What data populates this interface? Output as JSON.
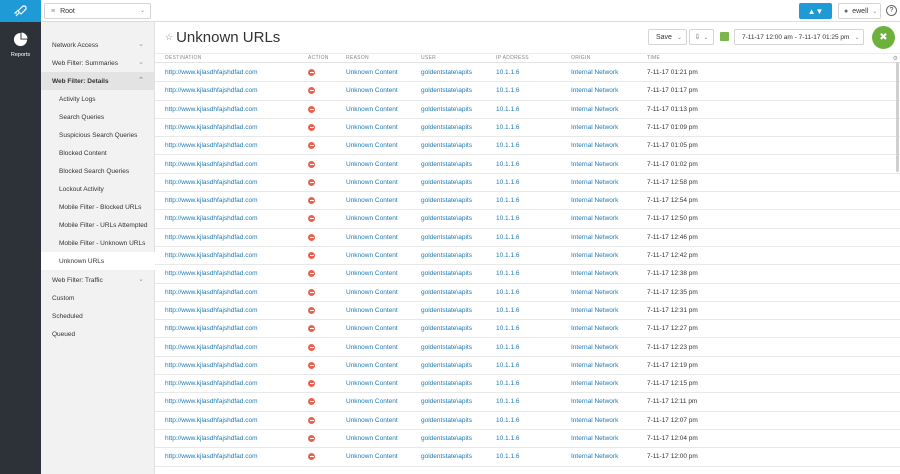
{
  "topbar": {
    "root_label": "Root",
    "user_label": "ewell",
    "help_label": "?"
  },
  "rail": {
    "reports_label": "Reports"
  },
  "sidebar": {
    "items": [
      {
        "label": "Network Access",
        "level": "top"
      },
      {
        "label": "Web Filter: Summaries",
        "level": "top"
      },
      {
        "label": "Web Filter: Details",
        "level": "top"
      },
      {
        "label": "Activity Logs",
        "level": "sub"
      },
      {
        "label": "Search Queries",
        "level": "sub"
      },
      {
        "label": "Suspicious Search Queries",
        "level": "sub"
      },
      {
        "label": "Blocked Content",
        "level": "sub"
      },
      {
        "label": "Blocked Search Queries",
        "level": "sub"
      },
      {
        "label": "Lockout Activity",
        "level": "sub"
      },
      {
        "label": "Mobile Filter - Blocked URLs",
        "level": "sub"
      },
      {
        "label": "Mobile Filter - URLs Attempted",
        "level": "sub"
      },
      {
        "label": "Mobile Filter - Unknown URLs",
        "level": "sub"
      },
      {
        "label": "Unknown URLs",
        "level": "sub"
      },
      {
        "label": "Web Filter: Traffic",
        "level": "top"
      },
      {
        "label": "Custom",
        "level": "top"
      },
      {
        "label": "Scheduled",
        "level": "top"
      },
      {
        "label": "Queued",
        "level": "top"
      }
    ]
  },
  "main": {
    "title": "Unknown URLs",
    "save_label": "Save",
    "date_range": "7-11-17 12:00 am - 7-11-17 01:25 pm"
  },
  "table": {
    "columns": [
      "DESTINATION",
      "ACTION",
      "REASON",
      "USER",
      "IP ADDRESS",
      "ORIGIN",
      "TIME"
    ],
    "rows": [
      {
        "destination": "http://www.kjlasdhfajshdfad.com",
        "reason": "Unknown Content",
        "user": "goldentstate\\apits",
        "ip": "10.1.1.6",
        "origin": "Internal Network",
        "time": "7-11-17 01:21 pm"
      },
      {
        "destination": "http://www.kjlasdhfajshdfad.com",
        "reason": "Unknown Content",
        "user": "goldentstate\\apits",
        "ip": "10.1.1.6",
        "origin": "Internal Network",
        "time": "7-11-17 01:17 pm"
      },
      {
        "destination": "http://www.kjlasdhfajshdfad.com",
        "reason": "Unknown Content",
        "user": "goldentstate\\apits",
        "ip": "10.1.1.6",
        "origin": "Internal Network",
        "time": "7-11-17 01:13 pm"
      },
      {
        "destination": "http://www.kjlasdhfajshdfad.com",
        "reason": "Unknown Content",
        "user": "goldentstate\\apits",
        "ip": "10.1.1.6",
        "origin": "Internal Network",
        "time": "7-11-17 01:09 pm"
      },
      {
        "destination": "http://www.kjlasdhfajshdfad.com",
        "reason": "Unknown Content",
        "user": "goldentstate\\apits",
        "ip": "10.1.1.6",
        "origin": "Internal Network",
        "time": "7-11-17 01:05 pm"
      },
      {
        "destination": "http://www.kjlasdhfajshdfad.com",
        "reason": "Unknown Content",
        "user": "goldentstate\\apits",
        "ip": "10.1.1.6",
        "origin": "Internal Network",
        "time": "7-11-17 01:02 pm"
      },
      {
        "destination": "http://www.kjlasdhfajshdfad.com",
        "reason": "Unknown Content",
        "user": "goldentstate\\apits",
        "ip": "10.1.1.6",
        "origin": "Internal Network",
        "time": "7-11-17 12:58 pm"
      },
      {
        "destination": "http://www.kjlasdhfajshdfad.com",
        "reason": "Unknown Content",
        "user": "goldentstate\\apits",
        "ip": "10.1.1.6",
        "origin": "Internal Network",
        "time": "7-11-17 12:54 pm"
      },
      {
        "destination": "http://www.kjlasdhfajshdfad.com",
        "reason": "Unknown Content",
        "user": "goldentstate\\apits",
        "ip": "10.1.1.6",
        "origin": "Internal Network",
        "time": "7-11-17 12:50 pm"
      },
      {
        "destination": "http://www.kjlasdhfajshdfad.com",
        "reason": "Unknown Content",
        "user": "goldentstate\\apits",
        "ip": "10.1.1.6",
        "origin": "Internal Network",
        "time": "7-11-17 12:46 pm"
      },
      {
        "destination": "http://www.kjlasdhfajshdfad.com",
        "reason": "Unknown Content",
        "user": "goldentstate\\apits",
        "ip": "10.1.1.6",
        "origin": "Internal Network",
        "time": "7-11-17 12:42 pm"
      },
      {
        "destination": "http://www.kjlasdhfajshdfad.com",
        "reason": "Unknown Content",
        "user": "goldentstate\\apits",
        "ip": "10.1.1.6",
        "origin": "Internal Network",
        "time": "7-11-17 12:38 pm"
      },
      {
        "destination": "http://www.kjlasdhfajshdfad.com",
        "reason": "Unknown Content",
        "user": "goldentstate\\apits",
        "ip": "10.1.1.6",
        "origin": "Internal Network",
        "time": "7-11-17 12:35 pm"
      },
      {
        "destination": "http://www.kjlasdhfajshdfad.com",
        "reason": "Unknown Content",
        "user": "goldentstate\\apits",
        "ip": "10.1.1.6",
        "origin": "Internal Network",
        "time": "7-11-17 12:31 pm"
      },
      {
        "destination": "http://www.kjlasdhfajshdfad.com",
        "reason": "Unknown Content",
        "user": "goldentstate\\apits",
        "ip": "10.1.1.6",
        "origin": "Internal Network",
        "time": "7-11-17 12:27 pm"
      },
      {
        "destination": "http://www.kjlasdhfajshdfad.com",
        "reason": "Unknown Content",
        "user": "goldentstate\\apits",
        "ip": "10.1.1.6",
        "origin": "Internal Network",
        "time": "7-11-17 12:23 pm"
      },
      {
        "destination": "http://www.kjlasdhfajshdfad.com",
        "reason": "Unknown Content",
        "user": "goldentstate\\apits",
        "ip": "10.1.1.6",
        "origin": "Internal Network",
        "time": "7-11-17 12:19 pm"
      },
      {
        "destination": "http://www.kjlasdhfajshdfad.com",
        "reason": "Unknown Content",
        "user": "goldentstate\\apits",
        "ip": "10.1.1.6",
        "origin": "Internal Network",
        "time": "7-11-17 12:15 pm"
      },
      {
        "destination": "http://www.kjlasdhfajshdfad.com",
        "reason": "Unknown Content",
        "user": "goldentstate\\apits",
        "ip": "10.1.1.6",
        "origin": "Internal Network",
        "time": "7-11-17 12:11 pm"
      },
      {
        "destination": "http://www.kjlasdhfajshdfad.com",
        "reason": "Unknown Content",
        "user": "goldentstate\\apits",
        "ip": "10.1.1.6",
        "origin": "Internal Network",
        "time": "7-11-17 12:07 pm"
      },
      {
        "destination": "http://www.kjlasdhfajshdfad.com",
        "reason": "Unknown Content",
        "user": "goldentstate\\apits",
        "ip": "10.1.1.6",
        "origin": "Internal Network",
        "time": "7-11-17 12:04 pm"
      },
      {
        "destination": "http://www.kjlasdhfajshdfad.com",
        "reason": "Unknown Content",
        "user": "goldentstate\\apits",
        "ip": "10.1.1.6",
        "origin": "Internal Network",
        "time": "7-11-17 12:00 pm"
      }
    ]
  },
  "icons": {
    "logo": "rocket-icon",
    "root": "hierarchy-icon",
    "thumbs": "thumbs-up-down-icon",
    "user": "user-icon",
    "help": "help-icon",
    "reports": "pie-chart-icon",
    "star": "star-icon",
    "export": "export-icon",
    "calendar": "calendar-icon",
    "fab": "tools-icon",
    "action": "block-icon",
    "settings": "gear-icon"
  },
  "colors": {
    "brand": "#1e9bd7",
    "rail": "#2d3238",
    "link": "#1d7ab4",
    "block": "#e8624f",
    "fab": "#6cb23a"
  }
}
